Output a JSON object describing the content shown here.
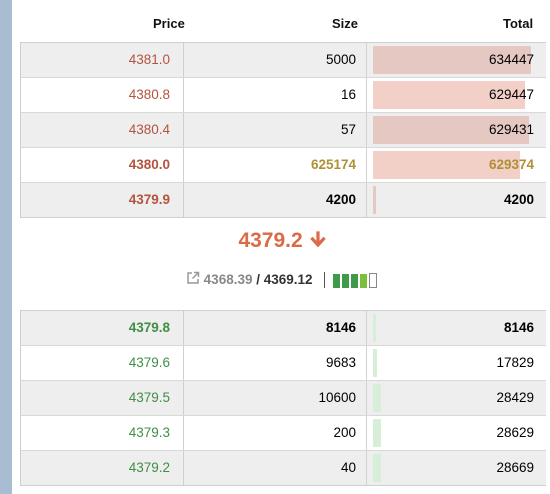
{
  "headers": {
    "price": "Price",
    "size": "Size",
    "total": "Total"
  },
  "asks": [
    {
      "price": "4380.0",
      "size": "625174",
      "total": "629374",
      "depth": 0.78,
      "style": "highlight"
    },
    {
      "price": "4380.4",
      "size": "57",
      "total": "629431",
      "depth": 0.83,
      "style": "normal"
    },
    {
      "price": "4380.8",
      "size": "16",
      "total": "629447",
      "depth": 0.81,
      "style": "normal"
    },
    {
      "price": "4381.0",
      "size": "5000",
      "total": "634447",
      "depth": 0.84,
      "style": "normal"
    }
  ],
  "best_ask": {
    "price": "4379.9",
    "size": "4200",
    "total": "4200"
  },
  "last_price": {
    "value": "4379.2",
    "arrow": "↓",
    "color": "#db6a47"
  },
  "index": {
    "mark": "4368.39",
    "separator": " / ",
    "last": "4369.12",
    "icon": "external-link-icon",
    "strength": [
      1,
      1,
      1,
      1,
      0
    ]
  },
  "best_bid": {
    "price": "4379.8",
    "size": "8146",
    "total": "8146"
  },
  "bids": [
    {
      "price": "4379.6",
      "size": "9683",
      "total": "17829",
      "depth": 0.02
    },
    {
      "price": "4379.5",
      "size": "10600",
      "total": "28429",
      "depth": 0.04
    },
    {
      "price": "4379.3",
      "size": "200",
      "total": "28629",
      "depth": 0.04
    },
    {
      "price": "4379.2",
      "size": "40",
      "total": "28669",
      "depth": 0.04
    }
  ],
  "colors": {
    "ask": "#b5533e",
    "bid": "#3f8f45",
    "ask_bar": "#f2cfc7",
    "ask_bar_dark": "#e5c8c2",
    "bid_bar": "#d7eed9"
  }
}
